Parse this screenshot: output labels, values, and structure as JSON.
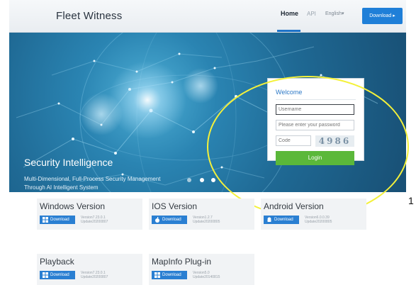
{
  "header": {
    "brand": "Fleet Witness",
    "nav": {
      "home": "Home",
      "api": "API",
      "language": "English"
    },
    "download_label": "Download"
  },
  "hero": {
    "title": "Security Intelligence",
    "line1": "Multi-Dimensional, Full-Process Security Management",
    "line2": "Through AI Intelligent System"
  },
  "login": {
    "title": "Welcome",
    "username_placeholder": "Username",
    "password_placeholder": "Please enter your password",
    "code_placeholder": "Code",
    "captcha": "4986",
    "button": "Login"
  },
  "annotation": {
    "label": "1",
    "color": "#f4f13a"
  },
  "products": [
    {
      "title": "Windows Version",
      "button": "Download",
      "icon": "windows-icon",
      "version": "Version7.23.0.1",
      "update": "Update20200807"
    },
    {
      "title": "IOS Version",
      "button": "Download",
      "icon": "apple-icon",
      "version": "Version1.2.7",
      "update": "Update20200805"
    },
    {
      "title": "Android Version",
      "button": "Download",
      "icon": "android-icon",
      "version": "Version6.0.0.39",
      "update": "Update20200805"
    },
    {
      "title": "Playback",
      "button": "Download",
      "icon": "windows-icon",
      "version": "Version7.23.0.1",
      "update": "Update20200807"
    },
    {
      "title": "MapInfo Plug-in",
      "button": "Download",
      "icon": "windows-icon",
      "version": "Version5.0",
      "update": "Update20140815"
    }
  ],
  "colors": {
    "accent": "#1f7fd8",
    "login_button": "#5bb83a",
    "welcome": "#2d79c7"
  }
}
